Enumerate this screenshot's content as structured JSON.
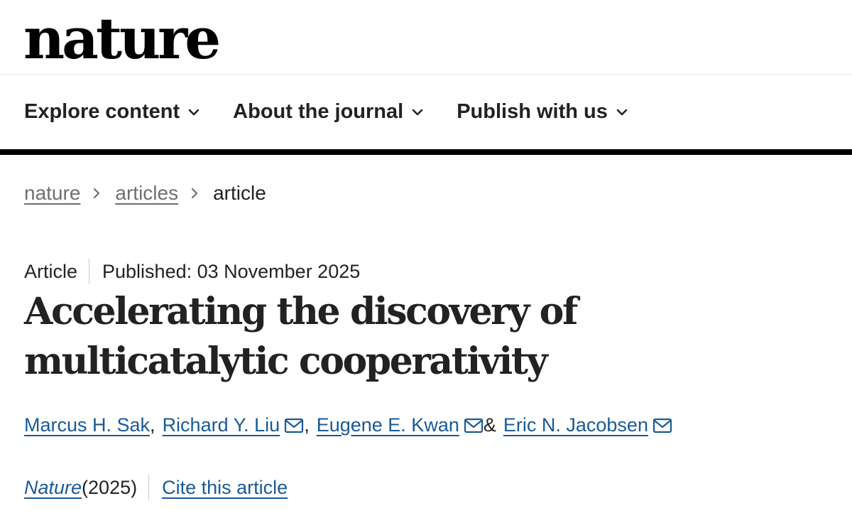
{
  "header": {
    "logo_text": "nature"
  },
  "nav": {
    "items": [
      {
        "label": "Explore content",
        "icon": "chevron-down-icon"
      },
      {
        "label": "About the journal",
        "icon": "chevron-down-icon"
      },
      {
        "label": "Publish with us",
        "icon": "chevron-down-icon"
      }
    ]
  },
  "breadcrumb": {
    "items": [
      {
        "label": "nature"
      },
      {
        "label": "articles"
      },
      {
        "label": "article"
      }
    ],
    "separator_icon": "chevron-right-icon"
  },
  "article": {
    "type": "Article",
    "published": "Published: 03 November 2025",
    "title": "Accelerating the discovery of multicatalytic cooperativity",
    "authors": [
      {
        "name": "Marcus H. Sak",
        "has_email": false,
        "after": ","
      },
      {
        "name": "Richard Y. Liu",
        "has_email": true,
        "after": ","
      },
      {
        "name": "Eugene E. Kwan",
        "has_email": true,
        "after": " &"
      },
      {
        "name": "Eric N. Jacobsen",
        "has_email": true,
        "after": ""
      }
    ],
    "citation": {
      "journal": "Nature",
      "year": " (2025)",
      "cite_label": "Cite this article"
    }
  },
  "colors": {
    "link": "#1a5a96",
    "text": "#222222",
    "muted": "#6f6f6f",
    "rule": "#000000"
  }
}
